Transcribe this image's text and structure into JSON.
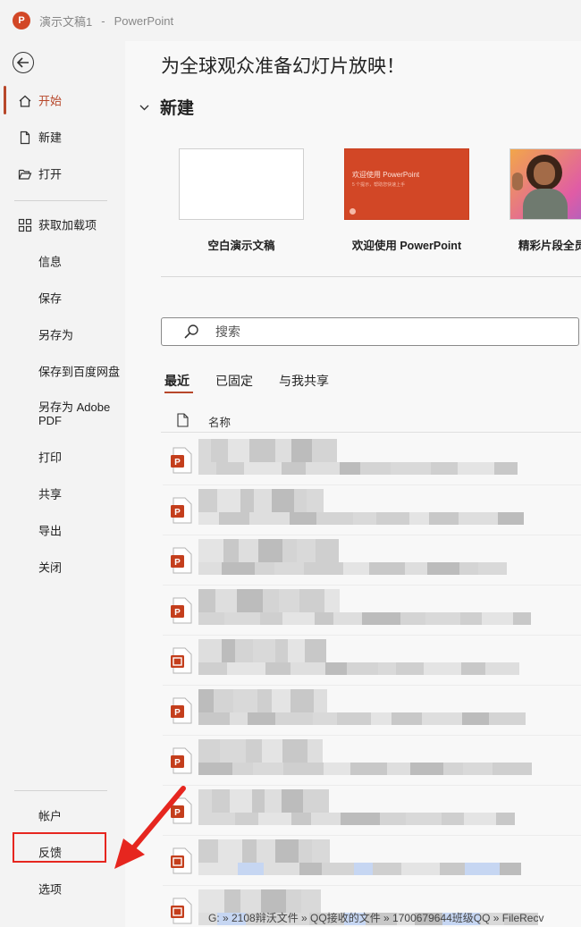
{
  "titlebar": {
    "doc_name": "演示文稿1",
    "separator": "-",
    "app_name": "PowerPoint"
  },
  "sidebar": {
    "items": [
      {
        "label": "开始"
      },
      {
        "label": "新建"
      },
      {
        "label": "打开"
      },
      {
        "label": "获取加载项"
      },
      {
        "label": "信息"
      },
      {
        "label": "保存"
      },
      {
        "label": "另存为"
      },
      {
        "label": "保存到百度网盘"
      },
      {
        "label": "另存为 Adobe PDF"
      },
      {
        "label": "打印"
      },
      {
        "label": "共享"
      },
      {
        "label": "导出"
      },
      {
        "label": "关闭"
      },
      {
        "label": "帐户"
      },
      {
        "label": "反馈"
      },
      {
        "label": "选项"
      }
    ]
  },
  "main": {
    "heading": "为全球观众准备幻灯片放映！",
    "new_section": {
      "title": "新建"
    },
    "templates": [
      {
        "caption": "空白演示文稿"
      },
      {
        "caption": "欢迎使用 PowerPoint",
        "thumb_title": "欢迎使用 PowerPoint",
        "thumb_subtitle": "5 个提示，帮助您快速上手"
      },
      {
        "caption": "精彩片段全员"
      }
    ],
    "search": {
      "placeholder": "搜索"
    },
    "tabs": [
      {
        "label": "最近"
      },
      {
        "label": "已固定"
      },
      {
        "label": "与我共享"
      }
    ],
    "column_name": "名称",
    "status_path": "G: » 2108辩沃文件 » QQ接收的文件 » 1700679644班级QQ » FileRecv"
  },
  "colors": {
    "accent": "#b7472a",
    "ppt_orange": "#d24726",
    "highlight_box": "#e6261f"
  }
}
